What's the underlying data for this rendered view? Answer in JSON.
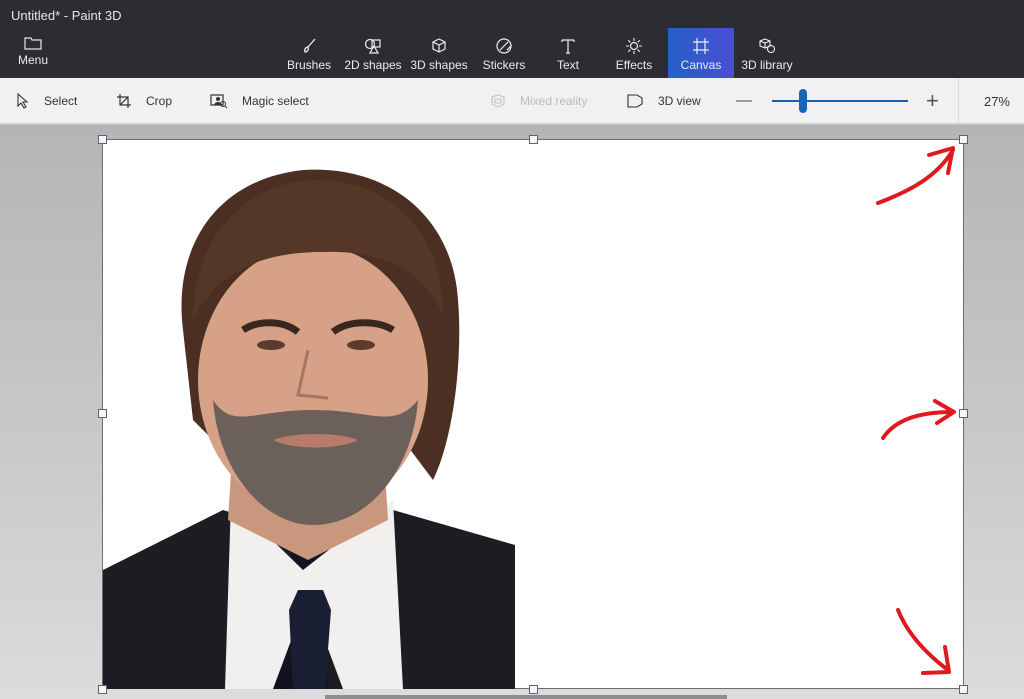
{
  "window": {
    "title": "Untitled* - Paint 3D"
  },
  "ribbon": {
    "menu": {
      "label": "Menu",
      "icon": "folder-icon"
    },
    "tools": [
      {
        "id": "brushes",
        "label": "Brushes",
        "icon": "brush-icon",
        "active": false
      },
      {
        "id": "2d-shapes",
        "label": "2D shapes",
        "icon": "2d-shapes-icon",
        "active": false
      },
      {
        "id": "3d-shapes",
        "label": "3D shapes",
        "icon": "3d-cube-icon",
        "active": false
      },
      {
        "id": "stickers",
        "label": "Stickers",
        "icon": "sticker-icon",
        "active": false
      },
      {
        "id": "text",
        "label": "Text",
        "icon": "text-icon",
        "active": false
      },
      {
        "id": "effects",
        "label": "Effects",
        "icon": "sun-icon",
        "active": false
      },
      {
        "id": "canvas",
        "label": "Canvas",
        "icon": "canvas-icon",
        "active": true
      },
      {
        "id": "3d-library",
        "label": "3D library",
        "icon": "3d-library-icon",
        "active": false
      }
    ],
    "active_color": "#2f5bd0"
  },
  "toolbar": {
    "select": "Select",
    "crop": "Crop",
    "magic_select": "Magic select",
    "mixed_reality": "Mixed reality",
    "view_3d": "3D view",
    "zoom_out": "—",
    "zoom_in": "+",
    "zoom_level_percent": 27,
    "zoom_label": "27%"
  },
  "canvas": {
    "background": "#ffffff",
    "content": "portrait photo of a man with brown hair and beard, dark suit, white shirt, navy tie",
    "annotations": [
      {
        "type": "arrow",
        "color": "#e0191e",
        "points_to": "top-right-resize-handle"
      },
      {
        "type": "arrow",
        "color": "#e0191e",
        "points_to": "right-middle-resize-handle"
      },
      {
        "type": "arrow",
        "color": "#e0191e",
        "points_to": "bottom-right-resize-handle"
      }
    ]
  }
}
